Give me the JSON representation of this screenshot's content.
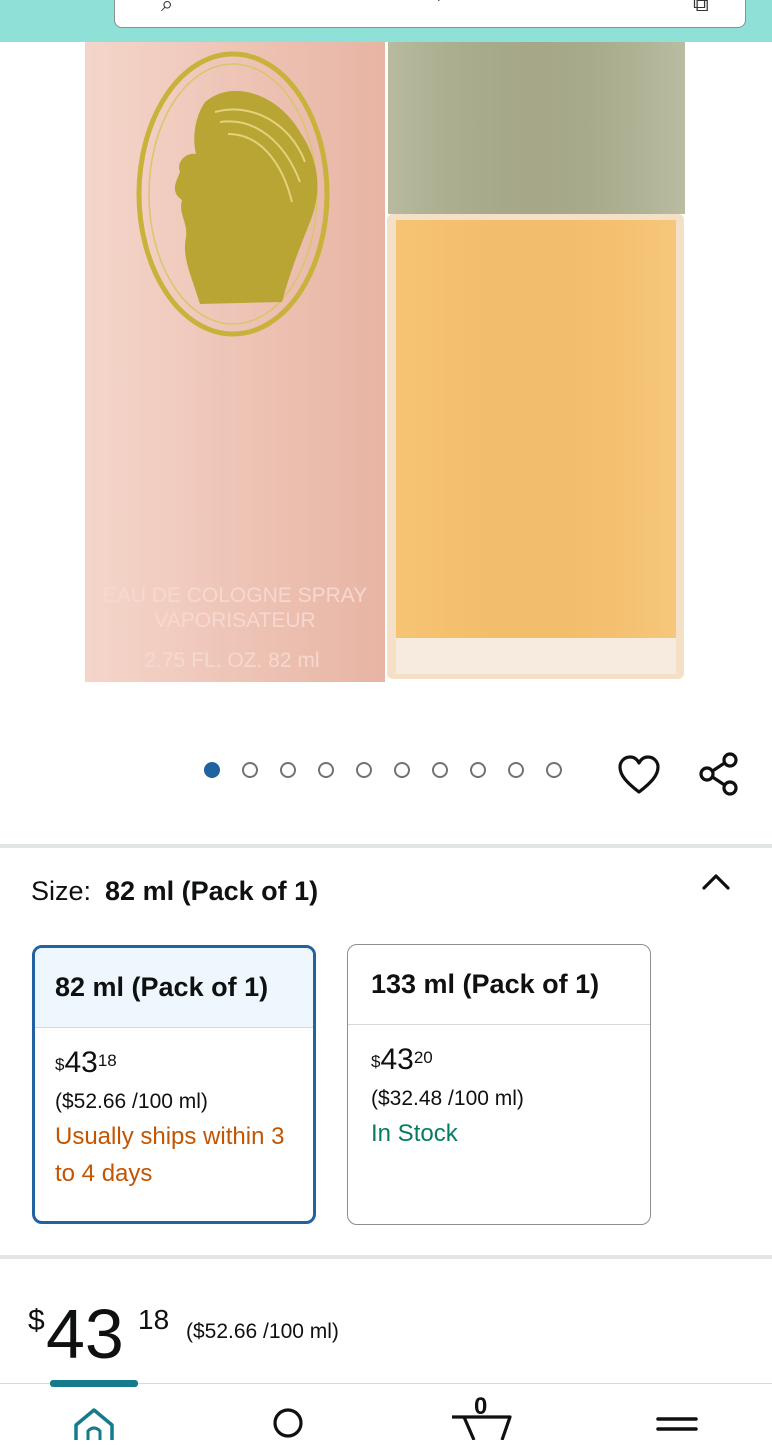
{
  "product": {
    "image_alt": "Perfume box and bottle",
    "box_text": [
      "EAU DE COLOGNE SPRAY",
      "VAPORISATEUR",
      "2.75 FL. OZ.  82 ml"
    ],
    "image_count": 10,
    "active_image_index": 0
  },
  "actions": {
    "wishlist_icon": "heart-icon",
    "share_icon": "share-icon"
  },
  "size_selector": {
    "label": "Size:",
    "selected_value": "82 ml (Pack of 1)",
    "options": [
      {
        "title": "82 ml (Pack of 1)",
        "currency": "$",
        "price_whole": "43",
        "price_fraction": "18",
        "unit_price": "($52.66 /100 ml)",
        "availability": "Usually ships within 3 to 4 days",
        "selected": true
      },
      {
        "title": "133 ml (Pack of 1)",
        "currency": "$",
        "price_whole": "43",
        "price_fraction": "20",
        "unit_price": "($32.48 /100 ml)",
        "availability": "In Stock",
        "selected": false
      }
    ]
  },
  "price": {
    "currency": "$",
    "whole": "43",
    "fraction": "18",
    "unit_price": "($52.66 /100 ml)"
  },
  "bottom_nav": {
    "cart_count": "0",
    "items": [
      "home-icon",
      "account-icon",
      "cart-icon",
      "menu-icon"
    ]
  },
  "colors": {
    "accent_blue": "#2162a1",
    "orange_text": "#c45500",
    "green_text": "#067d62",
    "top_bar": "#8fe0d6"
  }
}
